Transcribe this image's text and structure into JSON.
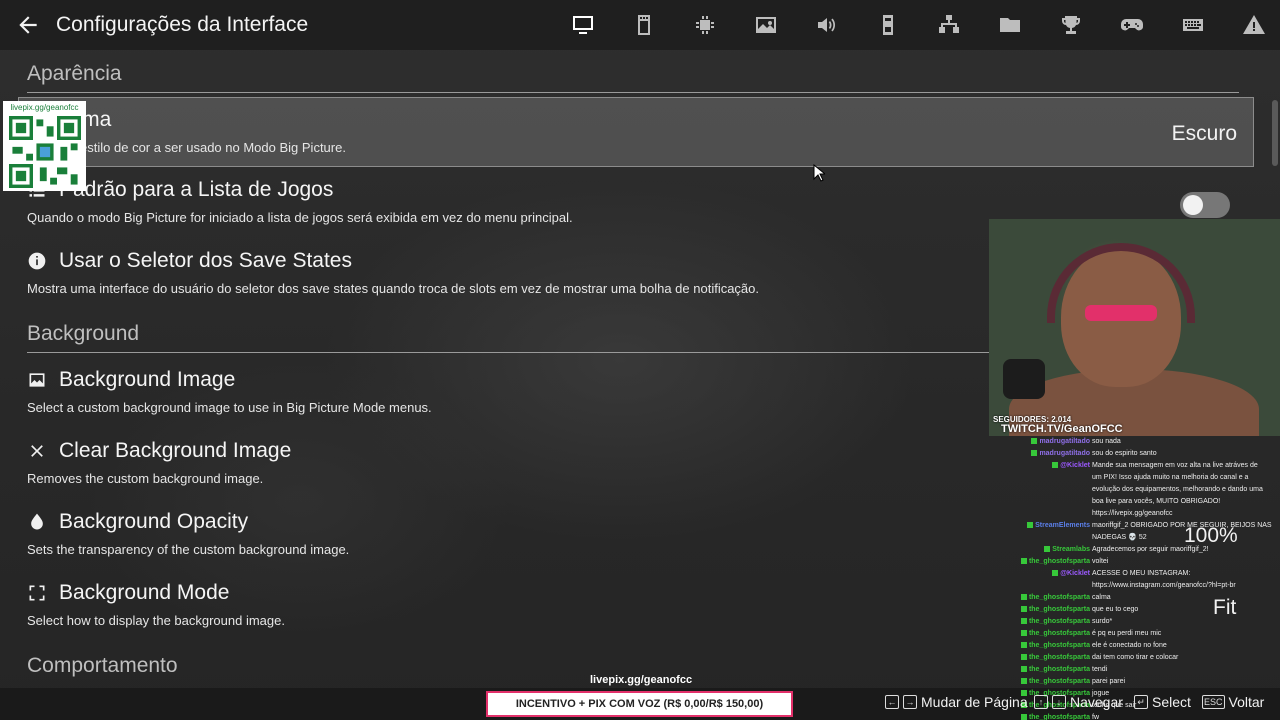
{
  "header": {
    "title": "Configurações da Interface",
    "icons": [
      "monitor-icon",
      "memory-card-icon",
      "chip-icon",
      "image-icon",
      "speaker-icon",
      "controller-port-icon",
      "network-icon",
      "folder-icon",
      "trophy-icon",
      "gamepad-icon",
      "keyboard-icon",
      "warning-icon"
    ]
  },
  "sections": {
    "appearance": "Aparência",
    "background": "Background",
    "behavior": "Comportamento"
  },
  "settings": {
    "theme": {
      "title": "Tema",
      "desc": "Define o estilo de cor a ser usado no Modo Big Picture.",
      "value": "Escuro"
    },
    "default_list": {
      "title": "Padrão para a Lista de Jogos",
      "desc": "Quando o modo Big Picture for iniciado a lista de jogos será exibida em vez do menu principal."
    },
    "save_selector": {
      "title": "Usar o Seletor dos Save States",
      "desc": "Mostra uma interface do usuário do seletor dos save states quando troca de slots em vez de mostrar uma bolha de notificação."
    },
    "bg_image": {
      "title": "Background Image",
      "desc": "Select a custom background image to use in Big Picture Mode menus."
    },
    "clear_bg": {
      "title": "Clear Background Image",
      "desc": "Removes the custom background image."
    },
    "bg_opacity": {
      "title": "Background Opacity",
      "desc": "Sets the transparency of the custom background image.",
      "value": "100%"
    },
    "bg_mode": {
      "title": "Background Mode",
      "desc": "Select how to display the background image.",
      "value": "Fit"
    }
  },
  "overlay": {
    "qr_label": "livepix.gg/geanofcc",
    "followers": "SEGUIDORES: 2.014",
    "channel": "TWITCH.TV/GeanOFCC",
    "livepix_url": "livepix.gg/geanofcc",
    "incentive": "INCENTIVO + PIX COM VOZ (R$ 0,00/R$ 150,00)"
  },
  "chat": [
    {
      "user": "madrugatiltado",
      "msg": "sou nada",
      "color": "#8f6fe8"
    },
    {
      "user": "madrugatiltado",
      "msg": "sou do espirito santo",
      "color": "#8f6fe8"
    },
    {
      "user": "@Kicklet",
      "msg": "Mande sua mensagem em voz alta na live atráves de",
      "color": "#9b59ff"
    },
    {
      "user": "",
      "msg": "um PIX! Isso ajuda muito na melhoria do canal e a",
      "color": "#ffffff"
    },
    {
      "user": "",
      "msg": "evolução dos equipamentos, melhorando e dando uma",
      "color": "#ffffff"
    },
    {
      "user": "",
      "msg": "boa live para vocês, MUITO OBRIGADO!",
      "color": "#ffffff"
    },
    {
      "user": "",
      "msg": "https://livepix.gg/geanofcc",
      "color": "#ffffff"
    },
    {
      "user": "StreamElements",
      "msg": "maoriffgif_2 OBRIGADO POR ME SEGUIR, BEIJOS NAS",
      "color": "#5b7fe8"
    },
    {
      "user": "",
      "msg": "NADEGAS 💀 52",
      "color": "#ffffff"
    },
    {
      "user": "Streamlabs",
      "msg": "Agradecemos por seguir maoriffgif_2!",
      "color": "#37c83a"
    },
    {
      "user": "the_ghostofsparta",
      "msg": "voltei",
      "color": "#37c83a"
    },
    {
      "user": "@Kicklet",
      "msg": "ACESSE O MEU INSTAGRAM:",
      "color": "#9b59ff"
    },
    {
      "user": "",
      "msg": "https://www.instagram.com/geanofcc/?hl=pt-br",
      "color": "#ffffff"
    },
    {
      "user": "the_ghostofsparta",
      "msg": "calma",
      "color": "#37c83a"
    },
    {
      "user": "the_ghostofsparta",
      "msg": "que eu to cego",
      "color": "#37c83a"
    },
    {
      "user": "the_ghostofsparta",
      "msg": "surdo*",
      "color": "#37c83a"
    },
    {
      "user": "the_ghostofsparta",
      "msg": "é pq eu perdi meu mic",
      "color": "#37c83a"
    },
    {
      "user": "the_ghostofsparta",
      "msg": "ele é conectado no fone",
      "color": "#37c83a"
    },
    {
      "user": "the_ghostofsparta",
      "msg": "dai tem como tirar e colocar",
      "color": "#37c83a"
    },
    {
      "user": "the_ghostofsparta",
      "msg": "tendi",
      "color": "#37c83a"
    },
    {
      "user": "the_ghostofsparta",
      "msg": "parei parei",
      "color": "#37c83a"
    },
    {
      "user": "the_ghostofsparta",
      "msg": "jogue",
      "color": "#37c83a"
    },
    {
      "user": "the_ghostofsparta",
      "msg": "tenho que sair",
      "color": "#37c83a"
    },
    {
      "user": "the_ghostofsparta",
      "msg": "fw",
      "color": "#37c83a"
    }
  ],
  "footer": {
    "change_page": "Mudar de Página",
    "navigate": "Navegar",
    "select": "Select",
    "back": "Voltar",
    "back_key": "ESC"
  },
  "colors": {
    "accent": "#e2306a",
    "chat_green": "#37c83a"
  }
}
